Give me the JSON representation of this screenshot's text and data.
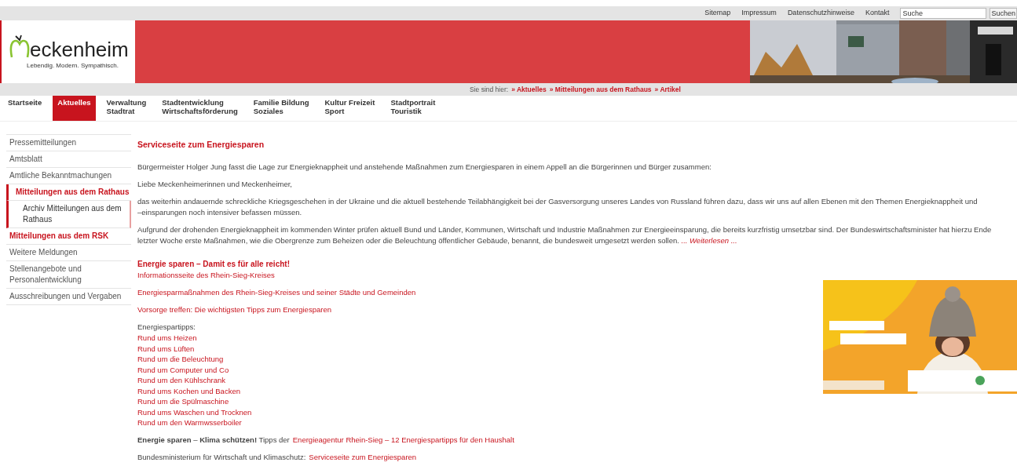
{
  "top_links": [
    "Sitemap",
    "Impressum",
    "Datenschutzhinweise",
    "Kontakt"
  ],
  "search": {
    "placeholder": "Suche",
    "button": "Suchen"
  },
  "logo": {
    "name": "eckenheim",
    "tagline": "Lebendig. Modern. Sympathisch."
  },
  "header_photo": {
    "kind": "picture"
  },
  "breadcrumb": {
    "label": "Sie sind hier:",
    "items": [
      "» Aktuelles",
      "» Mitteilungen aus dem Rathaus",
      "» Artikel"
    ]
  },
  "nav": [
    {
      "lines": [
        "Startseite"
      ],
      "selected": false
    },
    {
      "lines": [
        "Aktuelles"
      ],
      "selected": true
    },
    {
      "lines": [
        "Verwaltung",
        "Stadtrat"
      ],
      "selected": false
    },
    {
      "lines": [
        "Stadtentwicklung",
        "Wirtschaftsförderung"
      ],
      "selected": false
    },
    {
      "lines": [
        "Familie Bildung",
        "Soziales"
      ],
      "selected": false
    },
    {
      "lines": [
        "Kultur Freizeit",
        "Sport"
      ],
      "selected": false
    },
    {
      "lines": [
        "Stadtportrait",
        "Touristik"
      ],
      "selected": false
    }
  ],
  "sidebar": {
    "items": [
      {
        "label": "Pressemitteilungen",
        "selected": false,
        "kind": "normal"
      },
      {
        "label": "Amtsblatt",
        "selected": false,
        "kind": "normal"
      },
      {
        "label": "Amtliche Bekanntmachungen",
        "selected": false,
        "kind": "normal"
      },
      {
        "label": "Mitteilungen aus dem Rathaus",
        "selected": true,
        "kind": "highlight",
        "children": [
          {
            "label": "Archiv Mitteilungen aus dem Rathaus",
            "selected": false,
            "kind": "normal"
          }
        ]
      },
      {
        "label": "Mitteilungen aus dem RSK",
        "selected": false,
        "kind": "highlight"
      },
      {
        "label": "Weitere Meldungen",
        "selected": false,
        "kind": "normal"
      },
      {
        "label": "Stellenangebote und Personalentwicklung",
        "selected": false,
        "kind": "normal"
      },
      {
        "label": "Ausschreibungen und Vergaben",
        "selected": false,
        "kind": "normal"
      }
    ]
  },
  "article": {
    "title": "Serviceseite zum Energiesparen",
    "paragraphs": [
      {
        "lines": [
          "Bürgermeister Holger Jung fasst die Lage zur Energieknappheit und anstehende Maßnahmen zum Energiesparen in einem Appell an die Bürgerinnen und Bürger zusammen:"
        ]
      },
      {
        "lines": [
          "Liebe Meckenheimerinnen und Meckenheimer,"
        ]
      },
      {
        "lines": [
          "das weiterhin andauernde schreckliche Kriegsgeschehen in der Ukraine und die aktuell bestehende Teilabhängigkeit bei der Gasversorgung unseres Landes von Russland führen dazu, dass wir uns auf allen Ebenen mit den Themen Energieknappheit und",
          "–einsparungen noch intensiver befassen müssen."
        ]
      },
      {
        "lines": [
          "Aufgrund der drohenden Energieknappheit im kommenden Winter prüfen aktuell Bund und Länder, Kommunen, Wirtschaft und Industrie Maßnahmen zur Energieeinsparung, die bereits kurzfristig umsetzbar sind. Der Bundeswirtschaftsminister hat hierzu Ende",
          "letzter Woche erste Maßnahmen, wie die Obergrenze zum Beheizen oder die Beleuchtung öffentlicher Gebäude, benannt, die bundesweit umgesetzt werden sollen."
        ],
        "link": "... Weiterlesen ..."
      }
    ],
    "subheading": "Energie sparen – Damit es für alle reicht!",
    "links": [
      "Informationsseite des Rhein-Sieg-Kreises",
      "Energiesparmaßnahmen des Rhein-Sieg-Kreises und seiner Städte und Gemeinden",
      "Vorsorge treffen: Die wichtigsten Tipps zum Energiesparen"
    ],
    "tips_label": "Energiespartipps:",
    "tips": [
      "Rund ums Heizen",
      "Rund ums Lüften",
      "Rund um die Beleuchtung",
      "Rund um Computer und Co",
      "Rund um den Kühlschrank",
      "Rund ums Kochen und Backen",
      "Rund um die Spülmaschine",
      "Rund ums Waschen und Trocknen",
      "Rund um den Warmwsserboiler"
    ],
    "footer_lines": [
      {
        "text": "**Energie sparen** – **Klima schützen!** Tipps der",
        "link": "Energieagentur Rhein-Sieg – 12 Energiespartipps für den Haushalt"
      },
      {
        "text": "Bundesministerium für Wirtschaft und Klimaschutz:",
        "link": "Serviceseite zum Energiesparen"
      }
    ],
    "promo_image": {
      "kind": "picture"
    }
  }
}
